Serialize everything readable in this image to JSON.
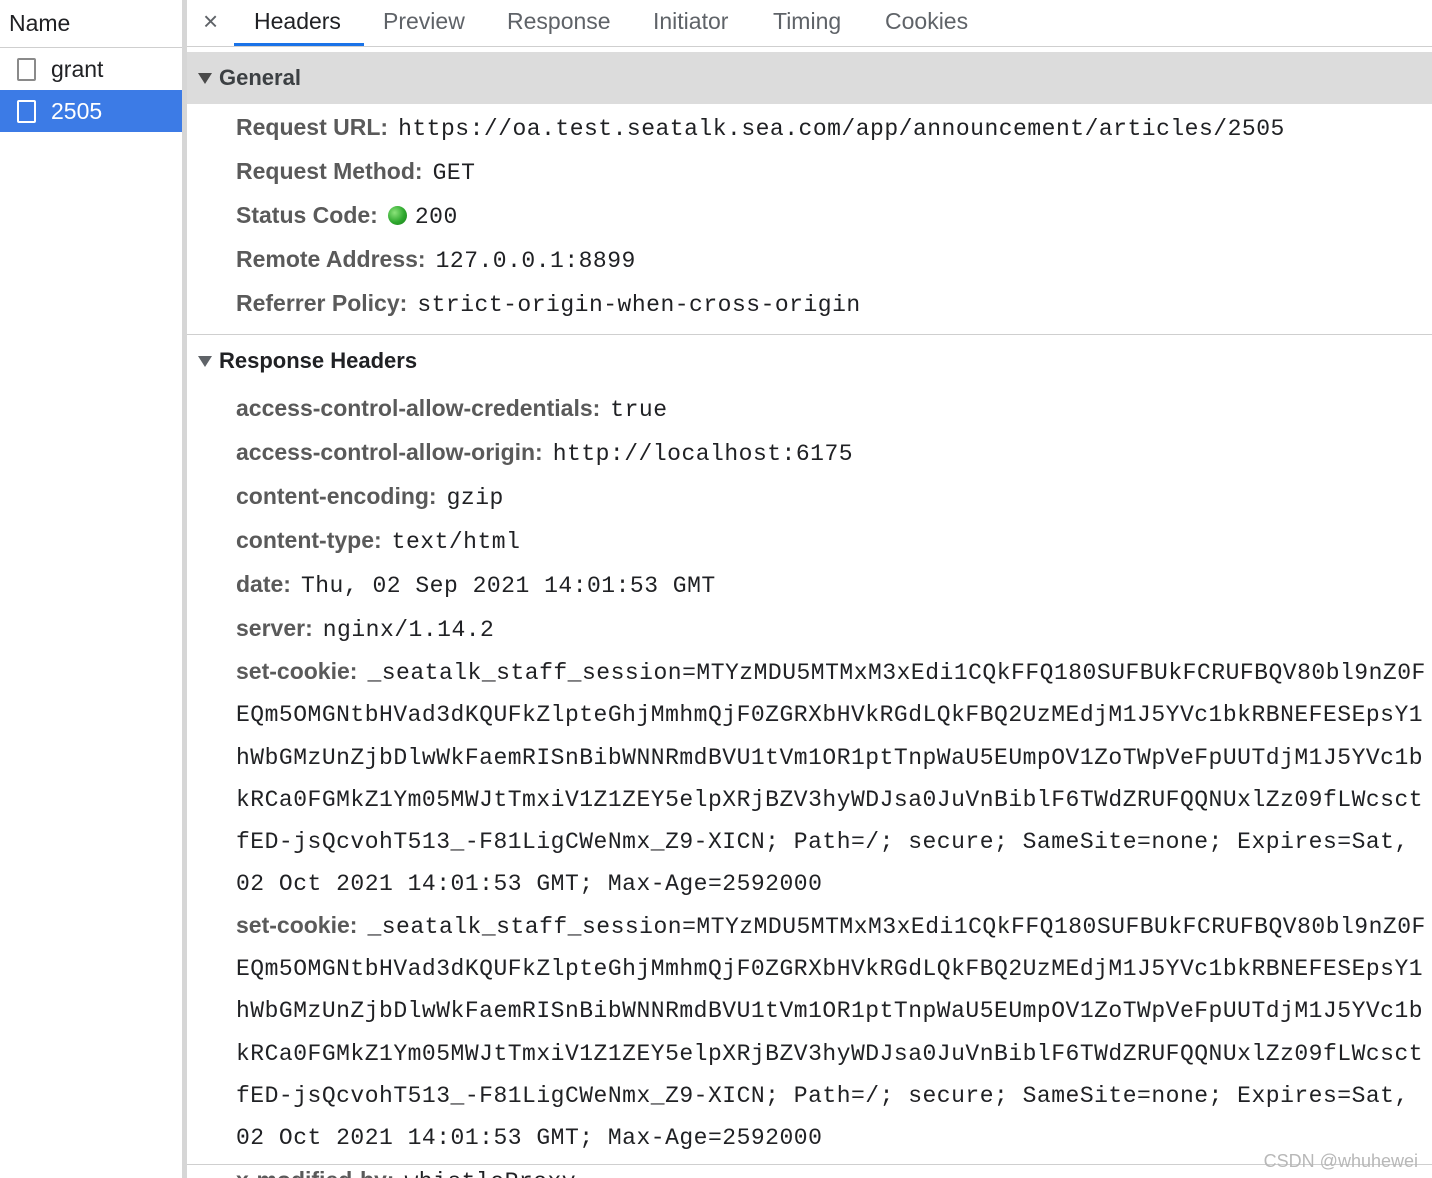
{
  "request_list": {
    "header": "Name",
    "items": [
      {
        "name": "grant",
        "selected": false
      },
      {
        "name": "2505",
        "selected": true
      }
    ]
  },
  "tabs": {
    "close": "×",
    "items": [
      "Headers",
      "Preview",
      "Response",
      "Initiator",
      "Timing",
      "Cookies"
    ],
    "active": "Headers"
  },
  "general": {
    "title": "General",
    "request_url_label": "Request URL:",
    "request_url": "https://oa.test.seatalk.sea.com/app/announcement/articles/2505",
    "request_method_label": "Request Method:",
    "request_method": "GET",
    "status_code_label": "Status Code:",
    "status_code": "200",
    "status_color": "#2ea82e",
    "remote_address_label": "Remote Address:",
    "remote_address": "127.0.0.1:8899",
    "referrer_policy_label": "Referrer Policy:",
    "referrer_policy": "strict-origin-when-cross-origin"
  },
  "response_headers": {
    "title": "Response Headers",
    "items": [
      {
        "name": "access-control-allow-credentials:",
        "value": "true"
      },
      {
        "name": "access-control-allow-origin:",
        "value": "http://localhost:6175"
      },
      {
        "name": "content-encoding:",
        "value": "gzip"
      },
      {
        "name": "content-type:",
        "value": "text/html"
      },
      {
        "name": "date:",
        "value": "Thu, 02 Sep 2021 14:01:53 GMT"
      },
      {
        "name": "server:",
        "value": "nginx/1.14.2"
      },
      {
        "name": "set-cookie:",
        "value": "_seatalk_staff_session=MTYzMDU5MTMxM3xEdi1CQkFFQ180SUFBUkFCRUFBQV80bl9nZ0FEQm5OMGNtbHVad3dKQUFkZlpteGhjMmhmQjF0ZGRXbHVkRGdLQkFBQ2UzMEdjM1J5YVc1bkRBNEFESEpsY1hWbGMzUnZjbDlwWkFaemRISnBibWNNRmdBVU1tVm1OR1ptTnpWaU5EUmpOV1ZoTWpVeFpUUTdjM1J5YVc1bkRCa0FGMkZ1Ym05MWJtTmxiV1Z1ZEY5elpXRjBZV3hyWDJsa0JuVnBiblF6TWdZRUFQQNUxlZz09fLWcsctfED-jsQcvohT513_-F81LigCWeNmx_Z9-XICN; Path=/; secure; SameSite=none; Expires=Sat, 02 Oct 2021 14:01:53 GMT; Max-Age=2592000"
      },
      {
        "name": "set-cookie:",
        "value": "_seatalk_staff_session=MTYzMDU5MTMxM3xEdi1CQkFFQ180SUFBUkFCRUFBQV80bl9nZ0FEQm5OMGNtbHVad3dKQUFkZlpteGhjMmhmQjF0ZGRXbHVkRGdLQkFBQ2UzMEdjM1J5YVc1bkRBNEFESEpsY1hWbGMzUnZjbDlwWkFaemRISnBibWNNRmdBVU1tVm1OR1ptTnpWaU5EUmpOV1ZoTWpVeFpUUTdjM1J5YVc1bkRCa0FGMkZ1Ym05MWJtTmxiV1Z1ZEY5elpXRjBZV3hyWDJsa0JuVnBiblF6TWdZRUFQQNUxlZz09fLWcsctfED-jsQcvohT513_-F81LigCWeNmx_Z9-XICN; Path=/; secure; SameSite=none; Expires=Sat, 02 Oct 2021 14:01:53 GMT; Max-Age=2592000"
      },
      {
        "name": "x-modified-by:",
        "value": "whistleProxy"
      }
    ]
  },
  "watermark": "CSDN @whuhewei",
  "colors": {
    "selected_row": "#3c7be6",
    "active_tab_underline": "#1a73e8",
    "general_header_bg": "#dcdcdc"
  }
}
